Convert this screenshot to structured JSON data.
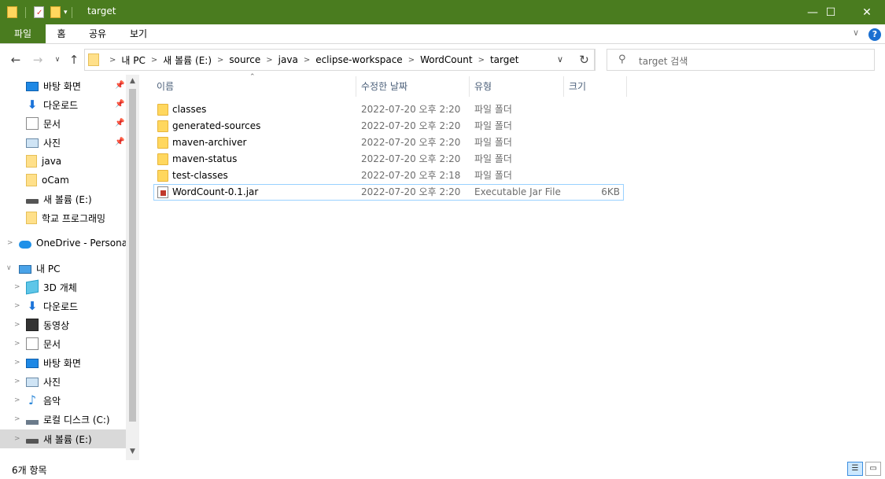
{
  "window": {
    "title": "target",
    "minimize_glyph": "—",
    "maximize_glyph": "☐",
    "close_glyph": "✕"
  },
  "ribbon": {
    "tabs": [
      "파일",
      "홈",
      "공유",
      "보기"
    ],
    "help_glyph": "?",
    "collapse_glyph": "∨"
  },
  "navigation": {
    "back_glyph": "←",
    "forward_glyph": "→",
    "recent_glyph": "∨",
    "up_glyph": "↑",
    "refresh_glyph": "↻",
    "dropdown_glyph": "∨"
  },
  "breadcrumbs": [
    "내 PC",
    "새 볼륨 (E:)",
    "source",
    "java",
    "eclipse-workspace",
    "WordCount",
    "target"
  ],
  "search": {
    "placeholder": "target 검색",
    "icon": "search-icon"
  },
  "nav_pane": {
    "quick_access": [
      {
        "label": "바탕 화면",
        "icon": "desktop-icon",
        "pinned": true
      },
      {
        "label": "다운로드",
        "icon": "download-icon",
        "pinned": true
      },
      {
        "label": "문서",
        "icon": "document-icon",
        "pinned": true
      },
      {
        "label": "사진",
        "icon": "pictures-icon",
        "pinned": true
      },
      {
        "label": "java",
        "icon": "folder-icon",
        "pinned": false
      },
      {
        "label": "oCam",
        "icon": "folder-icon",
        "pinned": false
      },
      {
        "label": "새 볼륨 (E:)",
        "icon": "drive-icon",
        "pinned": false
      },
      {
        "label": "학교 프로그래밍",
        "icon": "folder-icon",
        "pinned": false
      }
    ],
    "onedrive": "OneDrive - Personal",
    "this_pc": "내 PC",
    "pc_items": [
      {
        "label": "3D 개체",
        "icon": "3d-objects-icon"
      },
      {
        "label": "다운로드",
        "icon": "download-icon"
      },
      {
        "label": "동영상",
        "icon": "video-icon"
      },
      {
        "label": "문서",
        "icon": "document-icon"
      },
      {
        "label": "바탕 화면",
        "icon": "desktop-icon"
      },
      {
        "label": "사진",
        "icon": "pictures-icon"
      },
      {
        "label": "음악",
        "icon": "music-icon"
      },
      {
        "label": "로컬 디스크 (C:)",
        "icon": "local-disk-icon"
      },
      {
        "label": "새 볼륨 (E:)",
        "icon": "drive-icon",
        "selected": true
      }
    ]
  },
  "columns": {
    "name": "이름",
    "date": "수정한 날짜",
    "type": "유형",
    "size": "크기"
  },
  "files": [
    {
      "name": "classes",
      "date": "2022-07-20 오후 2:20",
      "type": "파일 폴더",
      "size": "",
      "icon": "folder-icon"
    },
    {
      "name": "generated-sources",
      "date": "2022-07-20 오후 2:20",
      "type": "파일 폴더",
      "size": "",
      "icon": "folder-icon"
    },
    {
      "name": "maven-archiver",
      "date": "2022-07-20 오후 2:20",
      "type": "파일 폴더",
      "size": "",
      "icon": "folder-icon"
    },
    {
      "name": "maven-status",
      "date": "2022-07-20 오후 2:20",
      "type": "파일 폴더",
      "size": "",
      "icon": "folder-icon"
    },
    {
      "name": "test-classes",
      "date": "2022-07-20 오후 2:18",
      "type": "파일 폴더",
      "size": "",
      "icon": "folder-icon"
    },
    {
      "name": "WordCount-0.1.jar",
      "date": "2022-07-20 오후 2:20",
      "type": "Executable Jar File",
      "size": "6KB",
      "icon": "jar-icon",
      "selected": true
    }
  ],
  "status": {
    "item_count": "6개 항목"
  },
  "colors": {
    "titlebar": "#4a7c1f",
    "selection_border": "#99d1ff",
    "nav_selected": "#d9d9d9"
  }
}
